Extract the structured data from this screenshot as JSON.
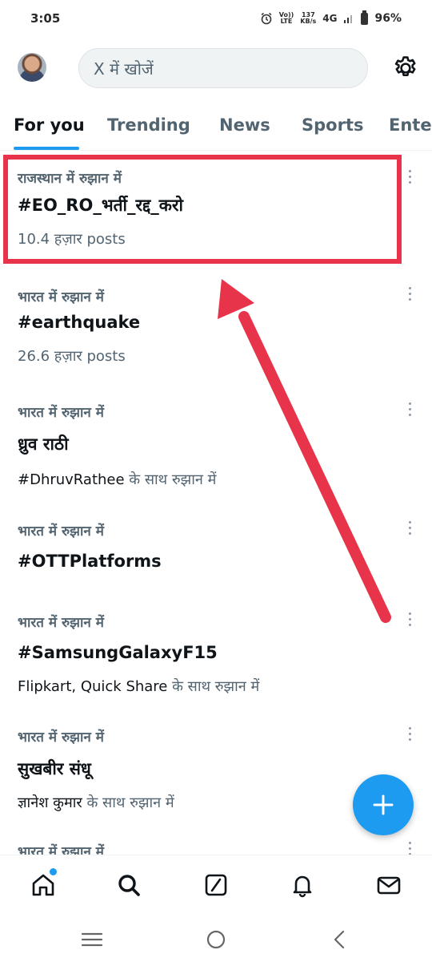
{
  "status_bar": {
    "time": "3:05",
    "volte_top": "Vo))",
    "volte_bottom": "LTE",
    "speed_value": "137",
    "speed_unit": "KB/s",
    "network": "4G",
    "battery": "96%",
    "icons": [
      "alarm-icon",
      "signal-icon",
      "battery-icon"
    ]
  },
  "header": {
    "search_placeholder": "X में खोजें",
    "settings_icon": "gear-icon"
  },
  "tabs": [
    {
      "label": "For you",
      "active": true
    },
    {
      "label": "Trending",
      "active": false
    },
    {
      "label": "News",
      "active": false
    },
    {
      "label": "Sports",
      "active": false
    },
    {
      "label": "Ente",
      "active": false
    }
  ],
  "trends": [
    {
      "context": "राजस्थान में रुझान में",
      "title": "#EO_RO_भर्ती_रद्द_करो",
      "meta": "10.4 हज़ार posts",
      "meta_dark": ""
    },
    {
      "context": "भारत में रुझान में",
      "title": "#earthquake",
      "meta": "26.6 हज़ार posts",
      "meta_dark": ""
    },
    {
      "context": "भारत में रुझान में",
      "title": "ध्रुव राठी",
      "meta": " के साथ रुझान में",
      "meta_dark": "#DhruvRathee"
    },
    {
      "context": "भारत में रुझान में",
      "title": "#OTTPlatforms",
      "meta": "",
      "meta_dark": ""
    },
    {
      "context": "भारत में रुझान में",
      "title": "#SamsungGalaxyF15",
      "meta": " के साथ रुझान में",
      "meta_dark": "Flipkart, Quick Share"
    },
    {
      "context": "भारत में रुझान में",
      "title": "सुखबीर संधू",
      "meta": " के साथ रुझान में",
      "meta_dark": "ज्ञानेश कुमार"
    },
    {
      "context": "भारत में रुझान में",
      "title": "",
      "meta": "",
      "meta_dark": ""
    }
  ],
  "colors": {
    "accent": "#1d9bf0",
    "highlight": "#e8344a",
    "muted_text": "#536471"
  },
  "bottom_nav": [
    "home-icon",
    "search-icon",
    "grok-icon",
    "notifications-icon",
    "messages-icon"
  ],
  "system_nav": [
    "recents-icon",
    "home-circle-icon",
    "back-icon"
  ]
}
